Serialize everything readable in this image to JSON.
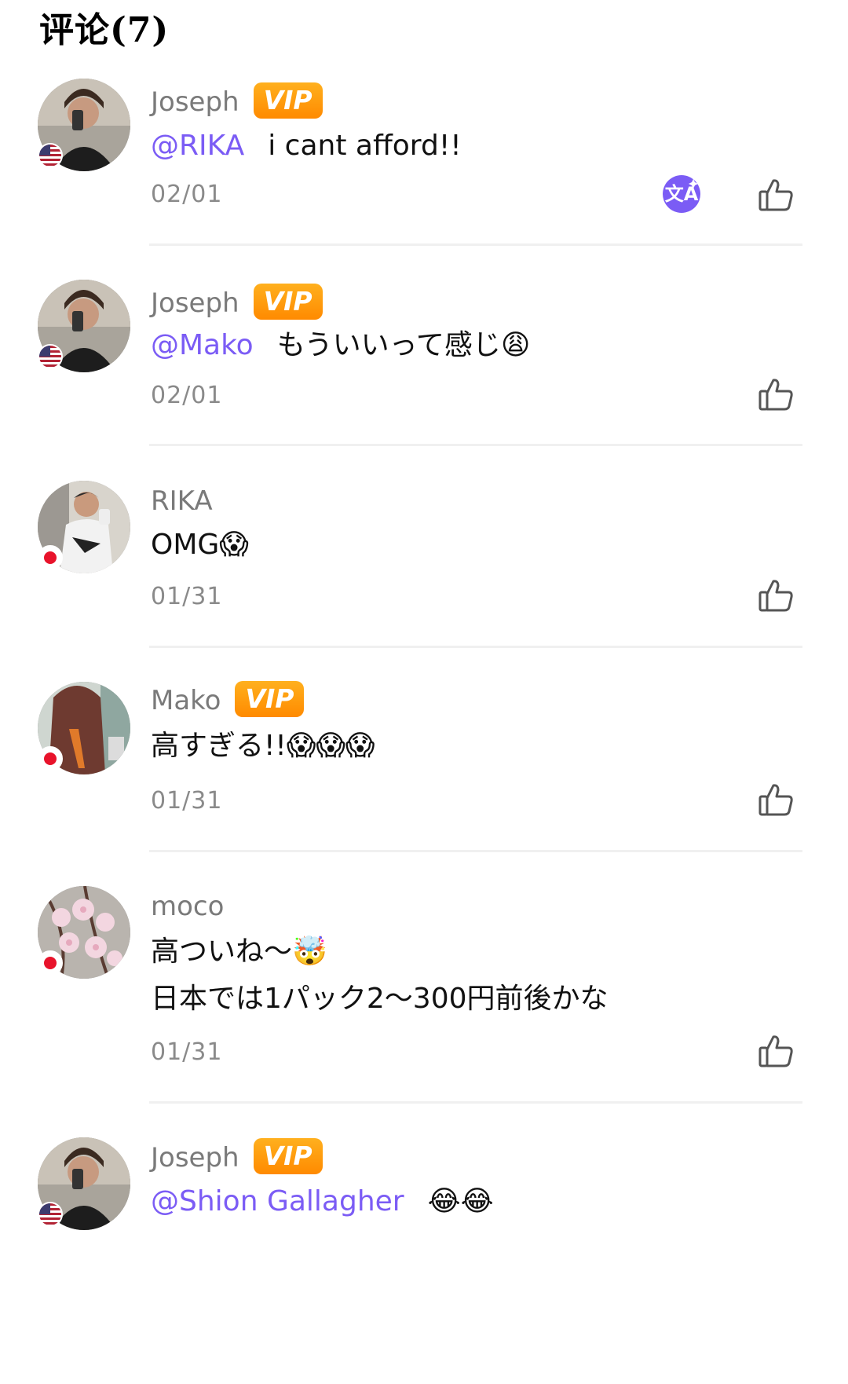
{
  "header": {
    "title": "评论(7)"
  },
  "comments": [
    {
      "username": "Joseph",
      "vip": true,
      "vip_label": "VIP",
      "mention": "@RIKA",
      "text": "i cant afford!!",
      "text2": "",
      "date": "02/01",
      "country": "us",
      "translate": true
    },
    {
      "username": "Joseph",
      "vip": true,
      "vip_label": "VIP",
      "mention": "@Mako",
      "text": "もういいって感じ😩",
      "text2": "",
      "date": "02/01",
      "country": "us",
      "translate": false
    },
    {
      "username": "RIKA",
      "vip": false,
      "mention": "",
      "text": "OMG😱",
      "text2": "",
      "date": "01/31",
      "country": "jp",
      "translate": false
    },
    {
      "username": "Mako",
      "vip": true,
      "vip_label": "VIP",
      "mention": "",
      "text": "高すぎる!!😱😱😱",
      "text2": "",
      "date": "01/31",
      "country": "jp",
      "translate": false
    },
    {
      "username": "moco",
      "vip": false,
      "mention": "",
      "text": "高ついね〜🤯",
      "text2": "日本では1パック2〜300円前後かな",
      "date": "01/31",
      "country": "jp",
      "translate": false
    },
    {
      "username": "Joseph",
      "vip": true,
      "vip_label": "VIP",
      "mention": "@Shion Gallagher",
      "text": "😂😂",
      "text2": "",
      "date": "",
      "country": "us",
      "translate": false
    }
  ],
  "icons": {
    "like": "thumbs-up-icon",
    "translate": "translate-icon"
  },
  "colors": {
    "mention": "#7b5cf5",
    "vip_gradient": [
      "#ffb01e",
      "#ff8a00"
    ],
    "translate_bg": "#7b5cf5"
  }
}
